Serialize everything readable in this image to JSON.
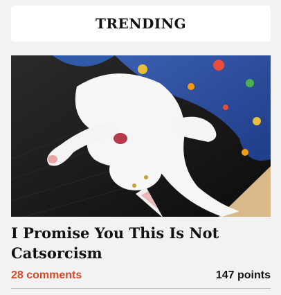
{
  "section": {
    "heading": "TRENDING"
  },
  "post": {
    "title": "I Promise You This Is Not Catsorcism",
    "comments": "28 comments",
    "points": "147 points",
    "image_subject": "white cat lying upside down on a dark rug"
  },
  "colors": {
    "background": "#f2f2f2",
    "comments_accent": "#d2492a",
    "text": "#111111"
  }
}
